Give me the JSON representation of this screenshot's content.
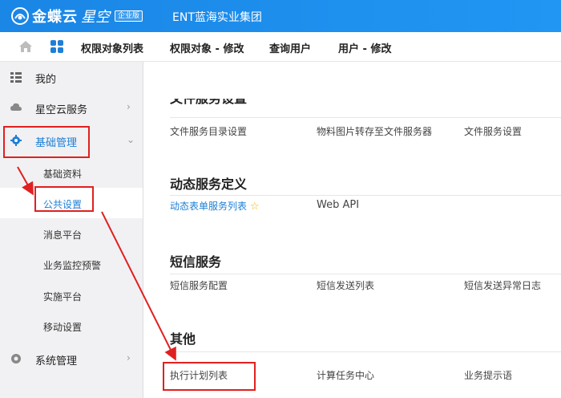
{
  "header": {
    "brand_main": "金蝶云",
    "brand_sub": "星空",
    "brand_badge": "企业版",
    "org_name": "ENT蓝海实业集团"
  },
  "tabs": [
    {
      "label": "权限对象列表"
    },
    {
      "label": "权限对象 - 修改"
    },
    {
      "label": "查询用户"
    },
    {
      "label": "用户 - 修改"
    }
  ],
  "sidebar": {
    "items": [
      {
        "label": "我的"
      },
      {
        "label": "星空云服务"
      },
      {
        "label": "基础管理"
      },
      {
        "label": "系统管理"
      }
    ],
    "subitems": [
      {
        "label": "基础资料"
      },
      {
        "label": "公共设置"
      },
      {
        "label": "消息平台"
      },
      {
        "label": "业务监控预警"
      },
      {
        "label": "实施平台"
      },
      {
        "label": "移动设置"
      }
    ]
  },
  "sections": [
    {
      "title": "文件服务设置",
      "items": [
        "文件服务目录设置",
        "物料图片转存至文件服务器",
        "文件服务设置"
      ]
    },
    {
      "title": "动态服务定义",
      "items": [
        "动态表单服务列表",
        "Web API"
      ]
    },
    {
      "title": "短信服务",
      "items": [
        "短信服务配置",
        "短信发送列表",
        "短信发送异常日志"
      ]
    },
    {
      "title": "其他",
      "items": [
        "执行计划列表",
        "计算任务中心",
        "业务提示语"
      ]
    }
  ],
  "colors": {
    "header_blue": "#1e8fe8",
    "link_blue": "#1d7fd6",
    "annotation_red": "#e02020",
    "star_gold": "#f0b400"
  }
}
